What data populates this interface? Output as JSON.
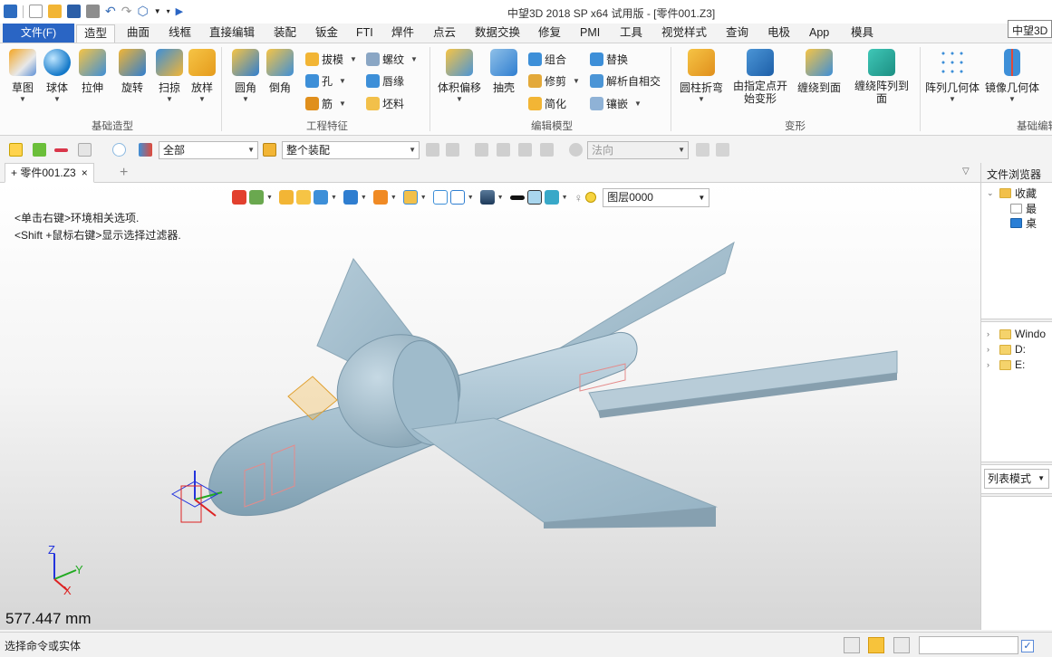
{
  "window": {
    "title": "中望3D 2018 SP x64 试用版 - [零件001.Z3]",
    "brand_label": "中望3D"
  },
  "menu_tabs": [
    "文件(F)",
    "造型",
    "曲面",
    "线框",
    "直接编辑",
    "装配",
    "钣金",
    "FTI",
    "焊件",
    "点云",
    "数据交换",
    "修复",
    "PMI",
    "工具",
    "视觉样式",
    "查询",
    "电极",
    "App",
    "模具"
  ],
  "ribbon": {
    "groups": [
      {
        "label": "基础造型",
        "buttons": [
          "草图",
          "球体",
          "拉伸",
          "旋转",
          "扫掠",
          "放样"
        ]
      },
      {
        "label": "工程特征",
        "buttons": [
          "圆角",
          "倒角"
        ],
        "small": [
          "拔模",
          "孔",
          "筋",
          "螺纹",
          "唇缘",
          "坯料"
        ]
      },
      {
        "label": "编辑模型",
        "buttons": [
          "体积偏移",
          "抽壳"
        ],
        "small": [
          "组合",
          "修剪",
          "简化",
          "替换",
          "解析自相交",
          "镶嵌"
        ]
      },
      {
        "label": "变形",
        "buttons": [
          "圆柱折弯",
          "由指定点开始变形",
          "缠绕到面",
          "缠绕阵列到面"
        ]
      },
      {
        "label": "基础编辑",
        "buttons": [
          "阵列几何体",
          "镜像几何体"
        ]
      }
    ]
  },
  "filter_bar": {
    "filter_value": "全部",
    "assembly_value": "整个装配",
    "direction_value": "法向"
  },
  "document": {
    "tab_label": "零件001.Z3",
    "tab_close": "×",
    "new_tab": "+"
  },
  "viewport": {
    "hint_line1": "<单击右键>环境相关选项.",
    "hint_line2": "<Shift +鼠标右键>显示选择过滤器.",
    "layer_value": "图层0000",
    "measure": "577.447 mm",
    "axes": {
      "x": "X",
      "y": "Y",
      "z": "Z"
    }
  },
  "file_browser": {
    "title": "文件浏览器",
    "favorites": "收藏",
    "fav_items": [
      "最",
      "桌"
    ],
    "drives": [
      "Windo",
      "D:",
      "E:"
    ],
    "list_mode": "列表模式"
  },
  "status": {
    "text": "选择命令或实体"
  },
  "colors": {
    "file_tab": "#2a65c4",
    "model": "#a8c2d1",
    "status_active": "#f7c33b"
  }
}
